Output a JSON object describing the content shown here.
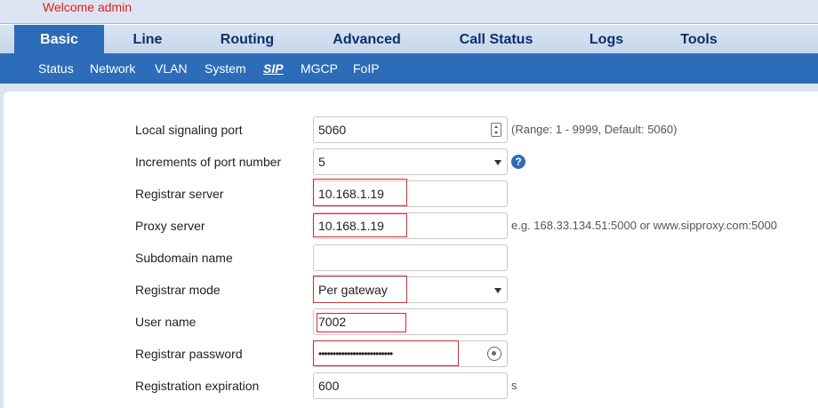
{
  "header": {
    "welcome": "Welcome admin"
  },
  "main_nav": {
    "tabs": [
      {
        "label": "Basic",
        "active": true
      },
      {
        "label": "Line"
      },
      {
        "label": "Routing"
      },
      {
        "label": "Advanced"
      },
      {
        "label": "Call Status"
      },
      {
        "label": "Logs"
      },
      {
        "label": "Tools"
      }
    ]
  },
  "sub_nav": {
    "items": [
      {
        "label": "Status"
      },
      {
        "label": "Network"
      },
      {
        "label": "VLAN"
      },
      {
        "label": "System"
      },
      {
        "label": "SIP",
        "active": true
      },
      {
        "label": "MGCP"
      },
      {
        "label": "FoIP"
      }
    ]
  },
  "form": {
    "local_port": {
      "label": "Local signaling port",
      "value": "5060",
      "hint": "(Range: 1 - 9999, Default: 5060)"
    },
    "port_increment": {
      "label": "Increments of port number",
      "value": "5"
    },
    "registrar_server": {
      "label": "Registrar server",
      "value": "10.168.1.19"
    },
    "proxy_server": {
      "label": "Proxy server",
      "value": "10.168.1.19",
      "hint": "e.g. 168.33.134.51:5000 or www.sipproxy.com:5000"
    },
    "subdomain": {
      "label": "Subdomain name",
      "value": ""
    },
    "registrar_mode": {
      "label": "Registrar mode",
      "value": "Per gateway"
    },
    "user_name": {
      "label": "User name",
      "value": "7002"
    },
    "registrar_password": {
      "label": "Registrar password",
      "value": "••••••••••••••••••••••••••"
    },
    "registration_expiration": {
      "label": "Registration expiration",
      "value": "600",
      "unit": "s"
    }
  },
  "icons": {
    "help": "help-icon",
    "spin": "spinner-icon",
    "eye": "eye-icon",
    "caret": "chevron-down-icon"
  },
  "colors": {
    "accent": "#2d6cb8",
    "highlight": "#e0272e",
    "welcome": "#e11d1d"
  }
}
